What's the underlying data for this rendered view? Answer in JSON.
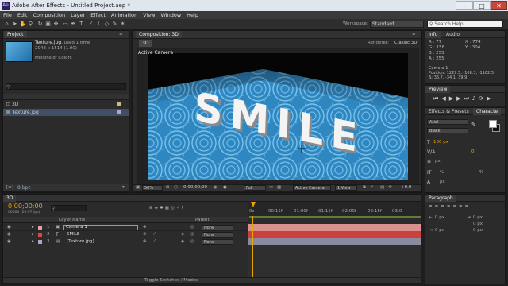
{
  "window": {
    "title": "Adobe After Effects - Untitled Project.aep *",
    "app_icon": "Ae"
  },
  "menu": [
    "File",
    "Edit",
    "Composition",
    "Layer",
    "Effect",
    "Animation",
    "View",
    "Window",
    "Help"
  ],
  "workspace": {
    "label": "Workspace:",
    "value": "Standard"
  },
  "search_help": "Search Help",
  "project": {
    "tab": "Project",
    "file_name": "Texture.jpg",
    "used": ", used 1 time",
    "dimensions": "2048 x 1514 (1.00)",
    "colors": "Millions of Colors",
    "items": [
      {
        "name": "3D"
      },
      {
        "name": "Texture.jpg"
      }
    ],
    "bpc": "8 bpc"
  },
  "composition": {
    "tab": "Composition: 3D",
    "subtab": "3D",
    "renderer_label": "Renderer:",
    "renderer": "Classic 3D",
    "active_camera_label": "Active Camera",
    "main_text": "SMILE",
    "zoom": "50%",
    "timecode": "0;00;00;00",
    "resolution": "Full",
    "camera_view": "Active Camera",
    "views": "1 View",
    "exposure": "+0.0"
  },
  "info": {
    "tab": "Info",
    "audio_tab": "Audio",
    "R": "R : 77",
    "G": "G : 158",
    "B": "B : 255",
    "A": "A : 255",
    "X": "X : 774",
    "Y": "Y : 304",
    "camera": "Camera 1",
    "position": "Position: 1229.5, -108.3, -1162.5",
    "delta": "Δ: 36.7, -34.1, 39.9"
  },
  "preview": {
    "tab": "Preview"
  },
  "effects": {
    "tab": "Effects & Presets",
    "character_tab": "Characte",
    "font": "Arial",
    "style": "Black",
    "size": "100 px",
    "tracking": "0",
    "leading_unit": "px",
    "px1": "px",
    "percent1": "%",
    "percent2": "%",
    "px2": "px"
  },
  "paragraph": {
    "tab": "Paragraph",
    "f1": "0 px",
    "f2": "0 px",
    "f3": "0 px",
    "f4": "0 px",
    "f5": "0 px"
  },
  "timeline": {
    "tab": "3D",
    "timecode": "0;00;00;00",
    "fps": "00000 (29.97 fps)",
    "col_layer": "Layer Name",
    "col_parent": "Parent",
    "ruler": [
      "0s",
      "00:15f",
      "01:00f",
      "01:15f",
      "02:00f",
      "02:15f",
      "03:0"
    ],
    "layers": [
      {
        "num": "1",
        "name": "Camera 1",
        "parent": "None"
      },
      {
        "num": "2",
        "name": "SMILE",
        "parent": "None"
      },
      {
        "num": "3",
        "name": "[Texture.jpg]",
        "parent": "None"
      }
    ],
    "toggle": "Toggle Switches / Modes"
  },
  "colors": {
    "accent": "#e8a400",
    "bg": "#2b2b2b",
    "camera_bar": "#d9918e",
    "text_bar": "#d48e8b",
    "texture_bar": "#8a8aa0",
    "water": "#2f87c2"
  }
}
